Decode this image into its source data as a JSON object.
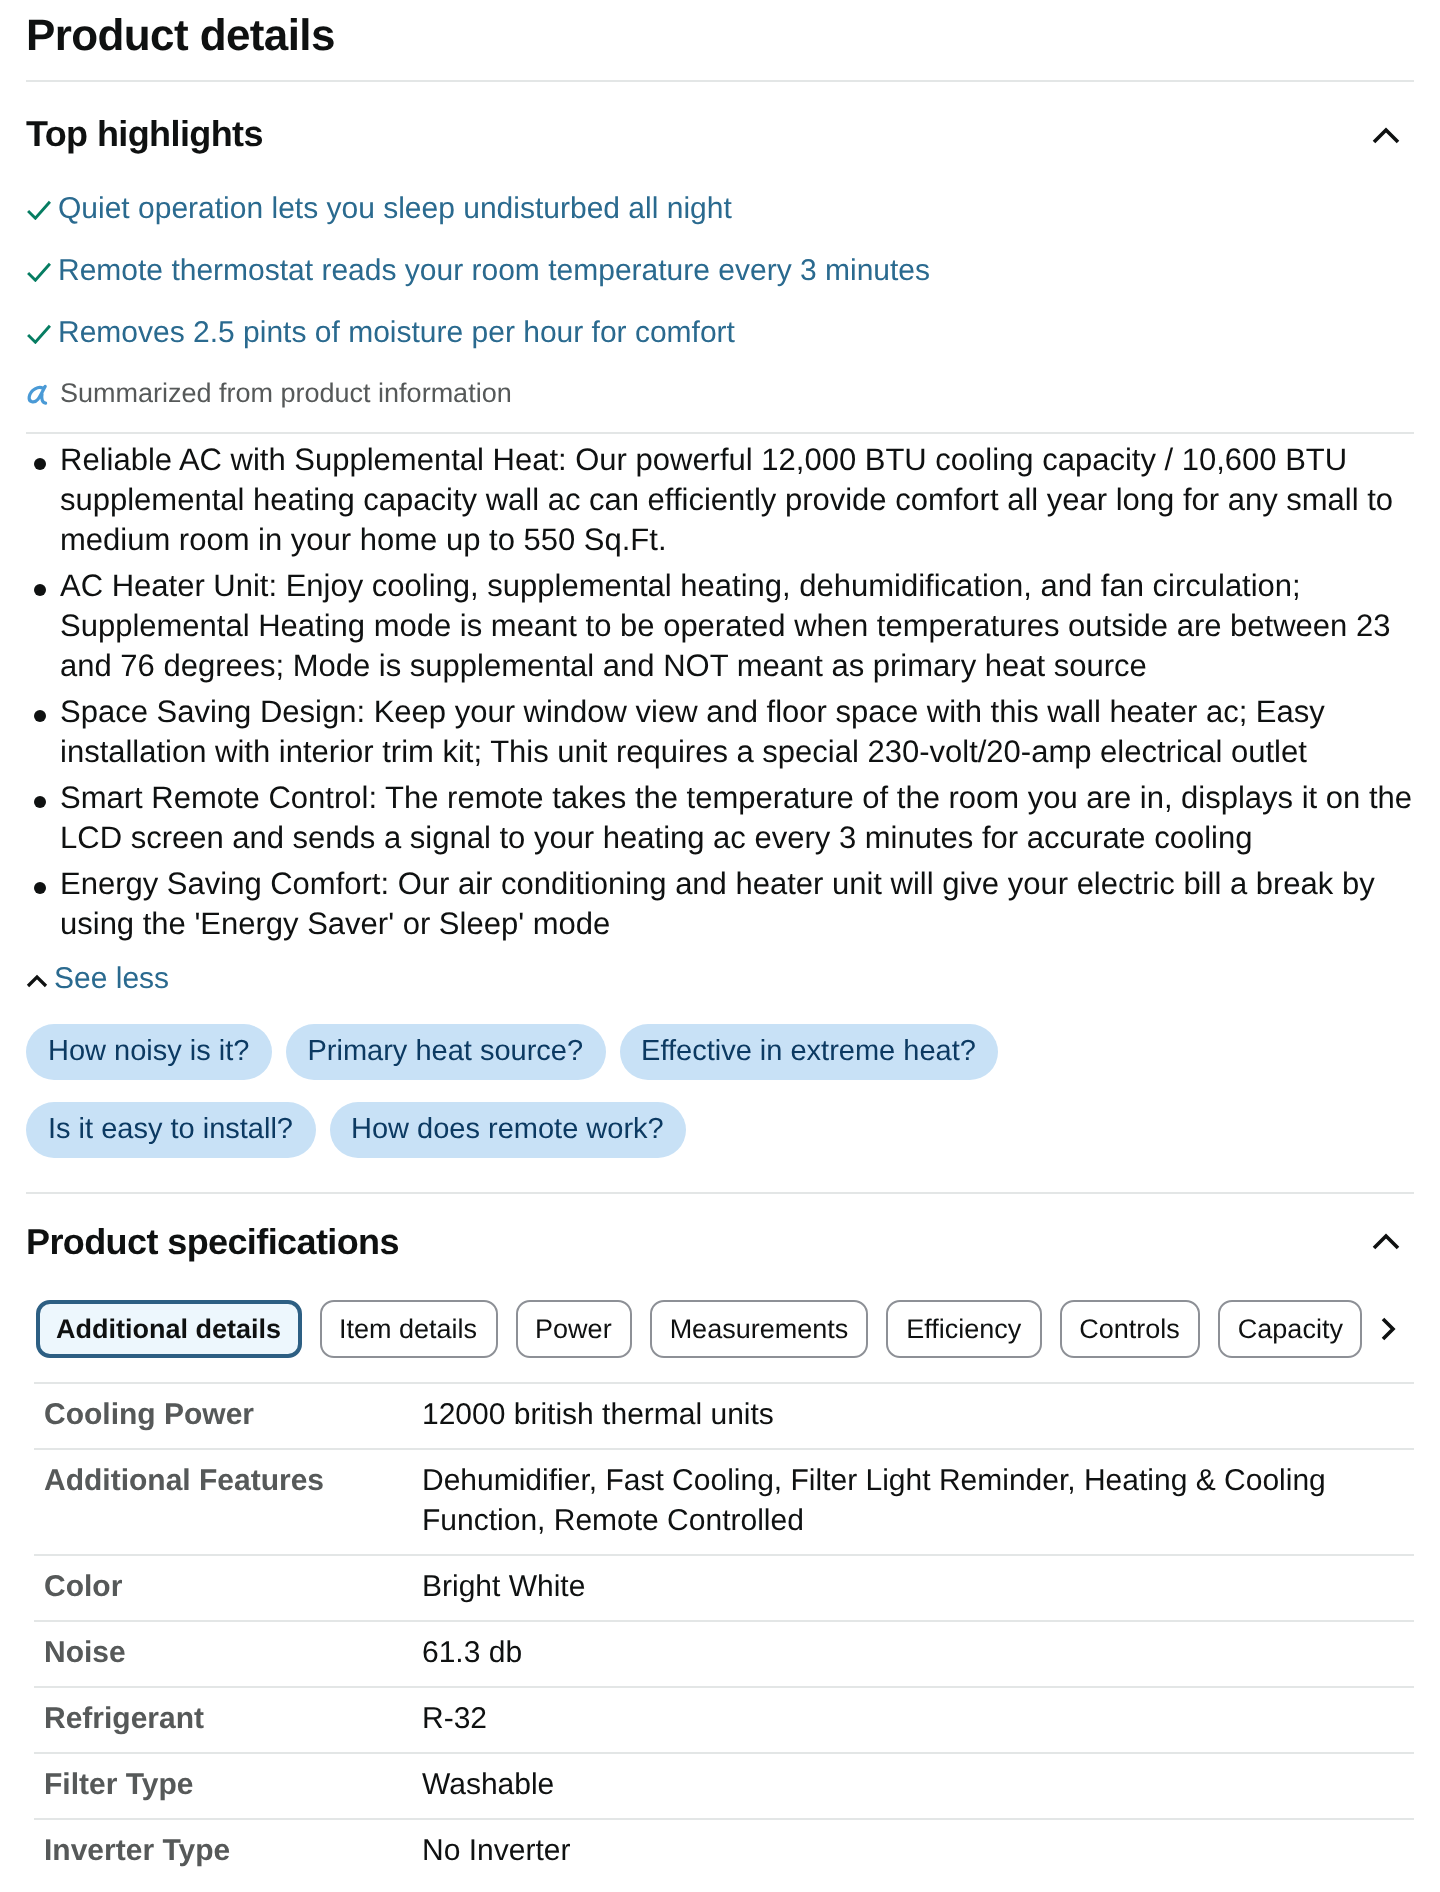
{
  "title": "Product details",
  "highlights_section": {
    "title": "Top highlights",
    "expanded": true,
    "highlights": [
      "Quiet operation lets you sleep undisturbed all night",
      "Remote thermostat reads your room temperature every 3 minutes",
      "Removes 2.5 pints of moisture per hour for comfort"
    ],
    "summary_note": "Summarized from product information",
    "bullets": [
      "Reliable AC with Supplemental Heat: Our powerful 12,000 BTU cooling capacity / 10,600 BTU supplemental heating capacity wall ac can efficiently provide comfort all year long for any small to medium room in your home up to 550 Sq.Ft.",
      "AC Heater Unit: Enjoy cooling, supplemental heating, dehumidification, and fan circulation; Supplemental Heating mode is meant to be operated when temperatures outside are between 23 and 76 degrees; Mode is supplemental and NOT meant as primary heat source",
      "Space Saving Design: Keep your window view and floor space with this wall heater ac; Easy installation with interior trim kit; This unit requires a special 230-volt/20-amp electrical outlet",
      "Smart Remote Control: The remote takes the temperature of the room you are in, displays it on the LCD screen and sends a signal to your heating ac every 3 minutes for accurate cooling",
      "Energy Saving Comfort: Our air conditioning and heater unit will give your electric bill a break by using the 'Energy Saver' or Sleep' mode"
    ],
    "toggle": "See less",
    "questions": [
      "How noisy is it?",
      "Primary heat source?",
      "Effective in extreme heat?",
      "Is it easy to install?",
      "How does remote work?"
    ]
  },
  "specifications_section": {
    "title": "Product specifications",
    "expanded": true,
    "tabs": [
      {
        "label": "Additional details",
        "selected": true
      },
      {
        "label": "Item details",
        "selected": false
      },
      {
        "label": "Power",
        "selected": false
      },
      {
        "label": "Measurements",
        "selected": false
      },
      {
        "label": "Efficiency",
        "selected": false
      },
      {
        "label": "Controls",
        "selected": false
      },
      {
        "label": "Capacity",
        "selected": false
      }
    ],
    "rows": [
      {
        "label": "Cooling Power",
        "value": "12000 british thermal units"
      },
      {
        "label": "Additional Features",
        "value": "Dehumidifier, Fast Cooling, Filter Light Reminder, Heating & Cooling Function, Remote Controlled"
      },
      {
        "label": "Color",
        "value": "Bright White"
      },
      {
        "label": "Noise",
        "value": "61.3 db"
      },
      {
        "label": "Refrigerant",
        "value": "R-32"
      },
      {
        "label": "Filter Type",
        "value": "Washable"
      },
      {
        "label": "Inverter Type",
        "value": "No Inverter"
      }
    ]
  }
}
